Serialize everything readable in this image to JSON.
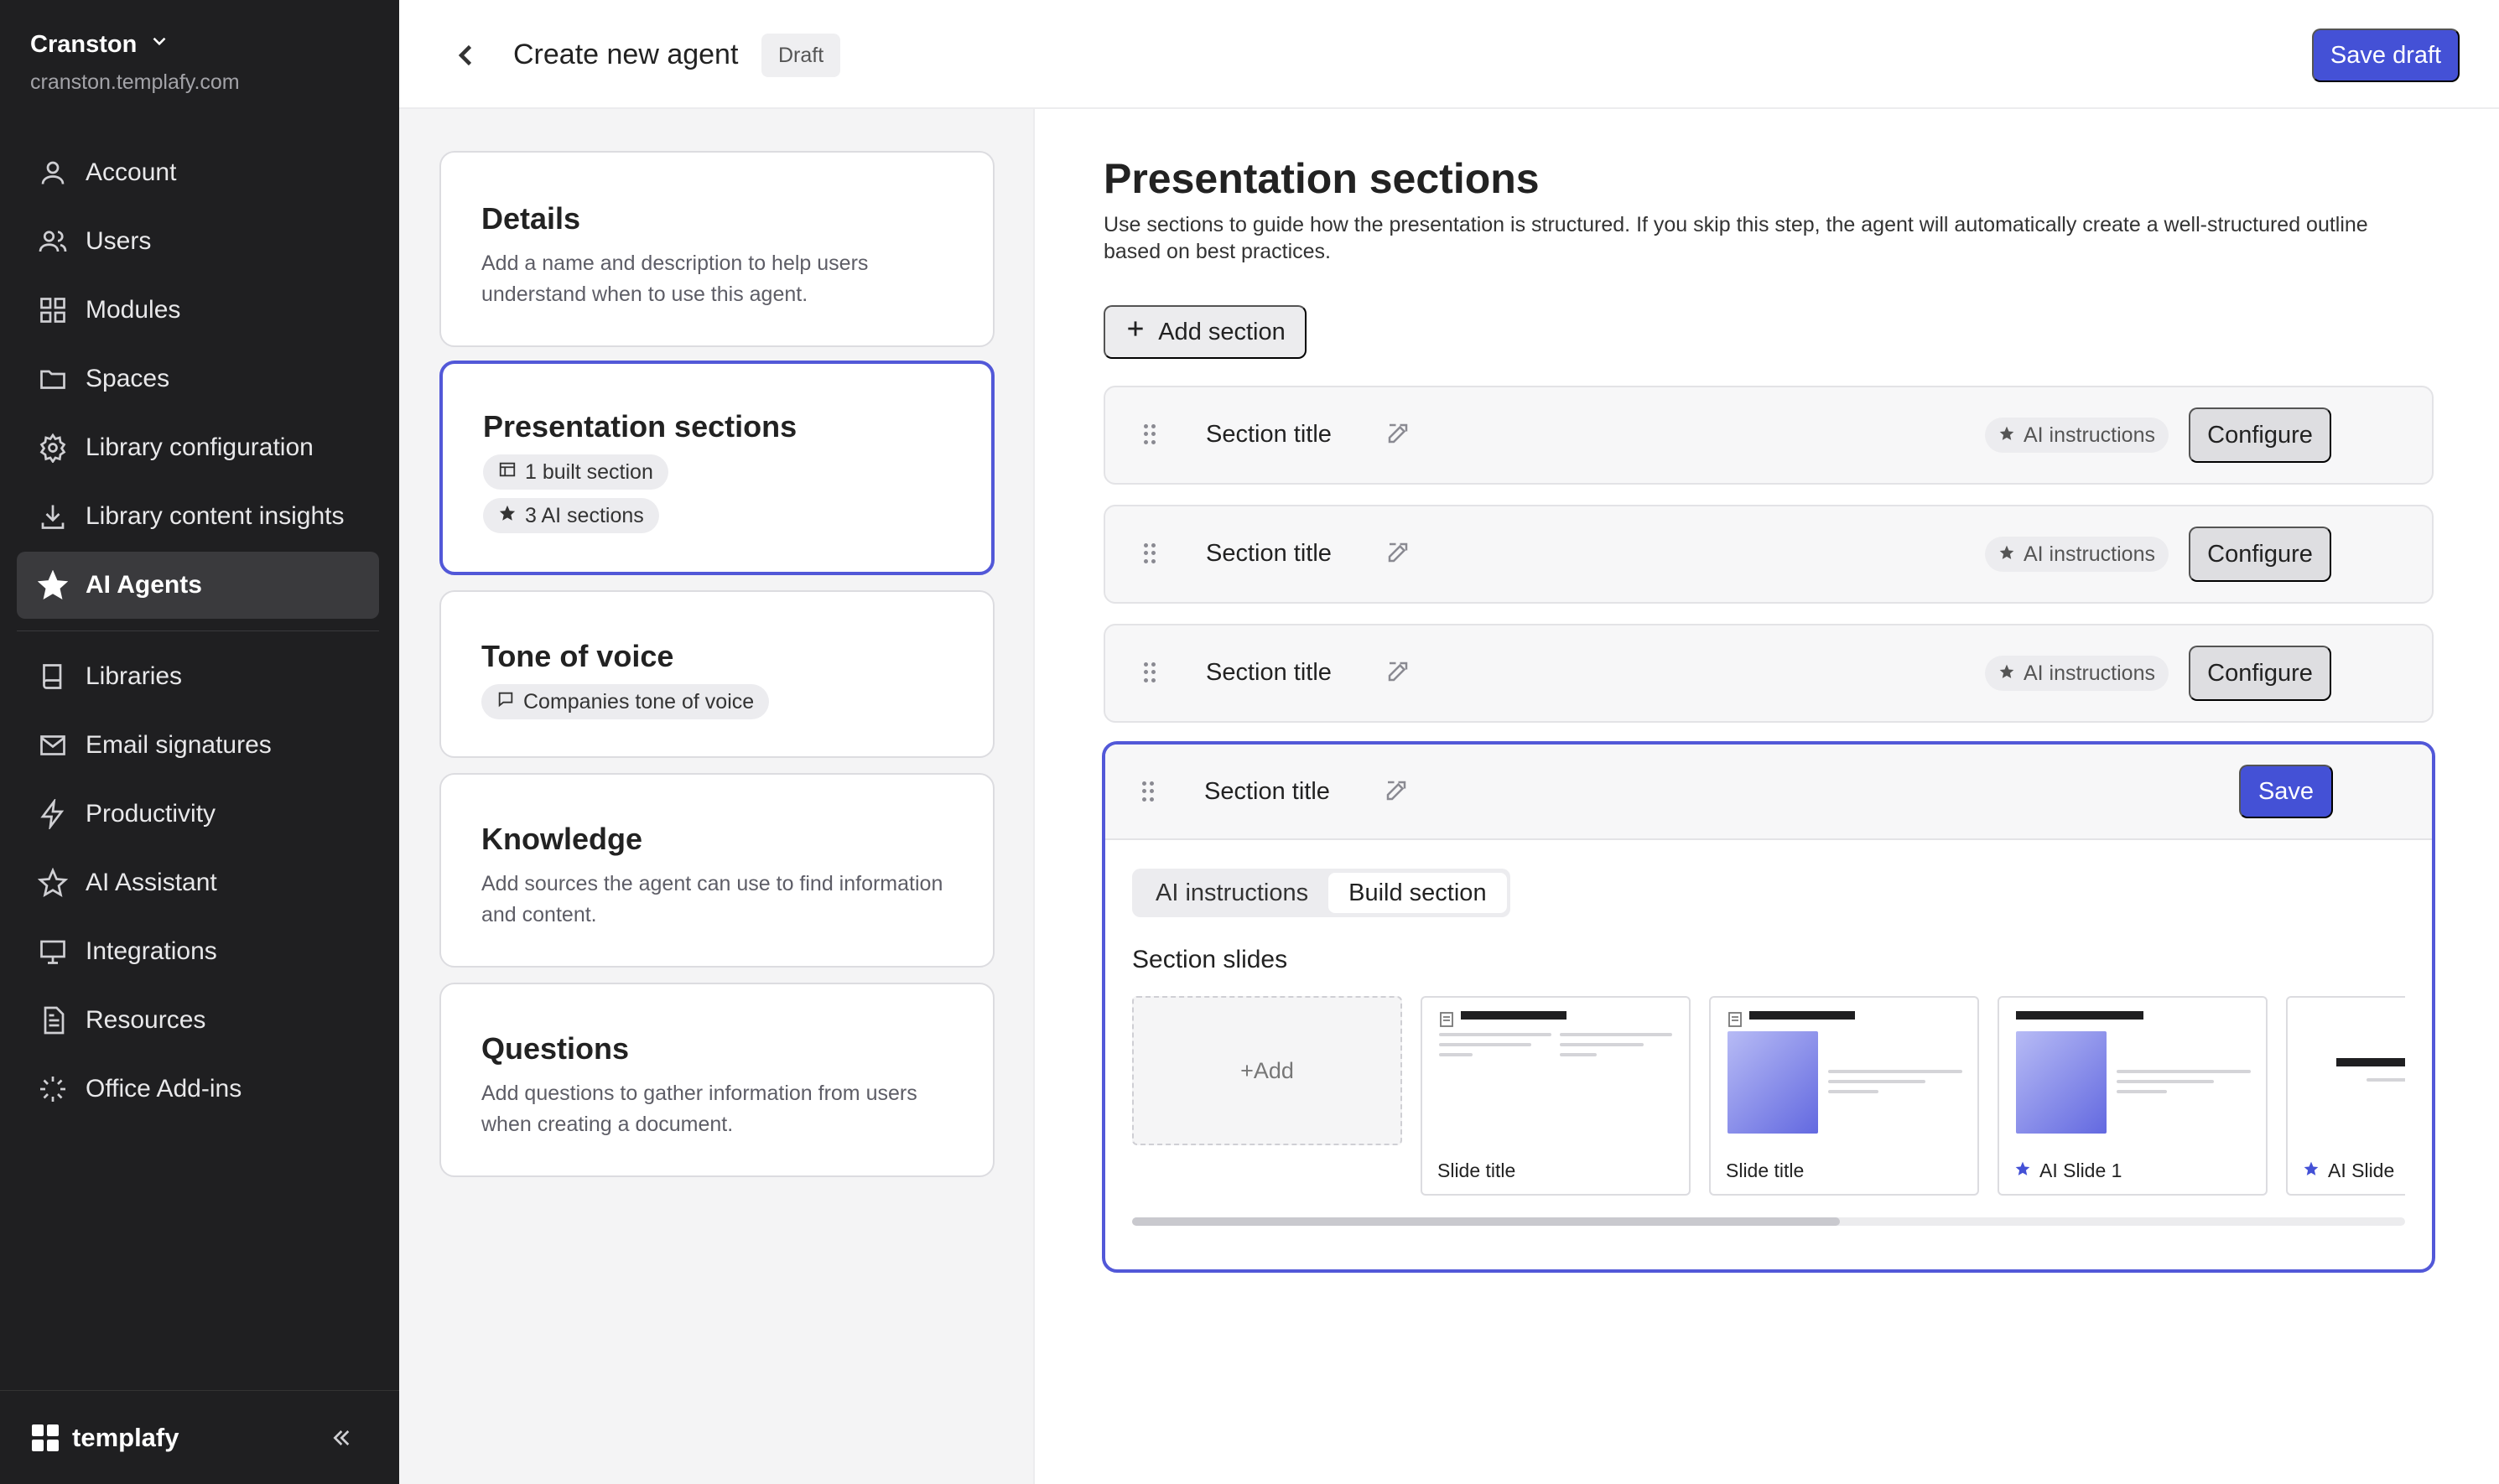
{
  "sidebar": {
    "org_name": "Cranston",
    "org_domain": "cranston.templafy.com",
    "items": [
      {
        "label": "Account",
        "icon": "user-icon"
      },
      {
        "label": "Users",
        "icon": "users-icon"
      },
      {
        "label": "Modules",
        "icon": "grid-icon"
      },
      {
        "label": "Spaces",
        "icon": "folder-icon"
      },
      {
        "label": "Library configuration",
        "icon": "gear-icon"
      },
      {
        "label": "Library content insights",
        "icon": "download-icon"
      },
      {
        "label": "AI Agents",
        "icon": "star-icon",
        "active": true
      }
    ],
    "items2": [
      {
        "label": "Libraries",
        "icon": "book-icon"
      },
      {
        "label": "Email signatures",
        "icon": "mail-icon"
      },
      {
        "label": "Productivity",
        "icon": "bolt-icon"
      },
      {
        "label": "AI Assistant",
        "icon": "star-outline-icon"
      },
      {
        "label": "Integrations",
        "icon": "monitor-icon"
      },
      {
        "label": "Resources",
        "icon": "document-icon"
      },
      {
        "label": "Office Add-ins",
        "icon": "spinner-icon"
      }
    ],
    "brand": "templafy"
  },
  "header": {
    "title": "Create new agent",
    "badge": "Draft",
    "save_draft": "Save draft"
  },
  "steps": {
    "details": {
      "title": "Details",
      "desc": "Add a name and description to help users understand when to use this agent."
    },
    "presentation": {
      "title": "Presentation sections",
      "chip1": "1 built section",
      "chip2": "3 AI sections"
    },
    "tone": {
      "title": "Tone of voice",
      "chip": "Companies tone of voice"
    },
    "knowledge": {
      "title": "Knowledge",
      "desc": "Add sources the agent can use to find information and content."
    },
    "questions": {
      "title": "Questions",
      "desc": "Add questions to gather information from users when creating a document."
    }
  },
  "main": {
    "title": "Presentation sections",
    "description": "Use sections to guide how the presentation is structured. If you skip this step, the agent will automatically create a well-structured outline based on best practices.",
    "add_section": "Add section",
    "sections": [
      {
        "title": "Section title",
        "tag": "AI instructions",
        "action": "Configure"
      },
      {
        "title": "Section title",
        "tag": "AI instructions",
        "action": "Configure"
      },
      {
        "title": "Section title",
        "tag": "AI instructions",
        "action": "Configure"
      }
    ],
    "open_section": {
      "title": "Section title",
      "save": "Save",
      "tabs": [
        "AI instructions",
        "Build section"
      ],
      "active_tab": "Build section",
      "slides_label": "Section slides",
      "add_slide": "+Add",
      "slides": [
        "Slide title",
        "Slide title",
        "AI Slide 1",
        "AI Slide"
      ]
    }
  },
  "colors": {
    "accent": "#4451d6",
    "sidebar_bg": "#1f1f21"
  }
}
